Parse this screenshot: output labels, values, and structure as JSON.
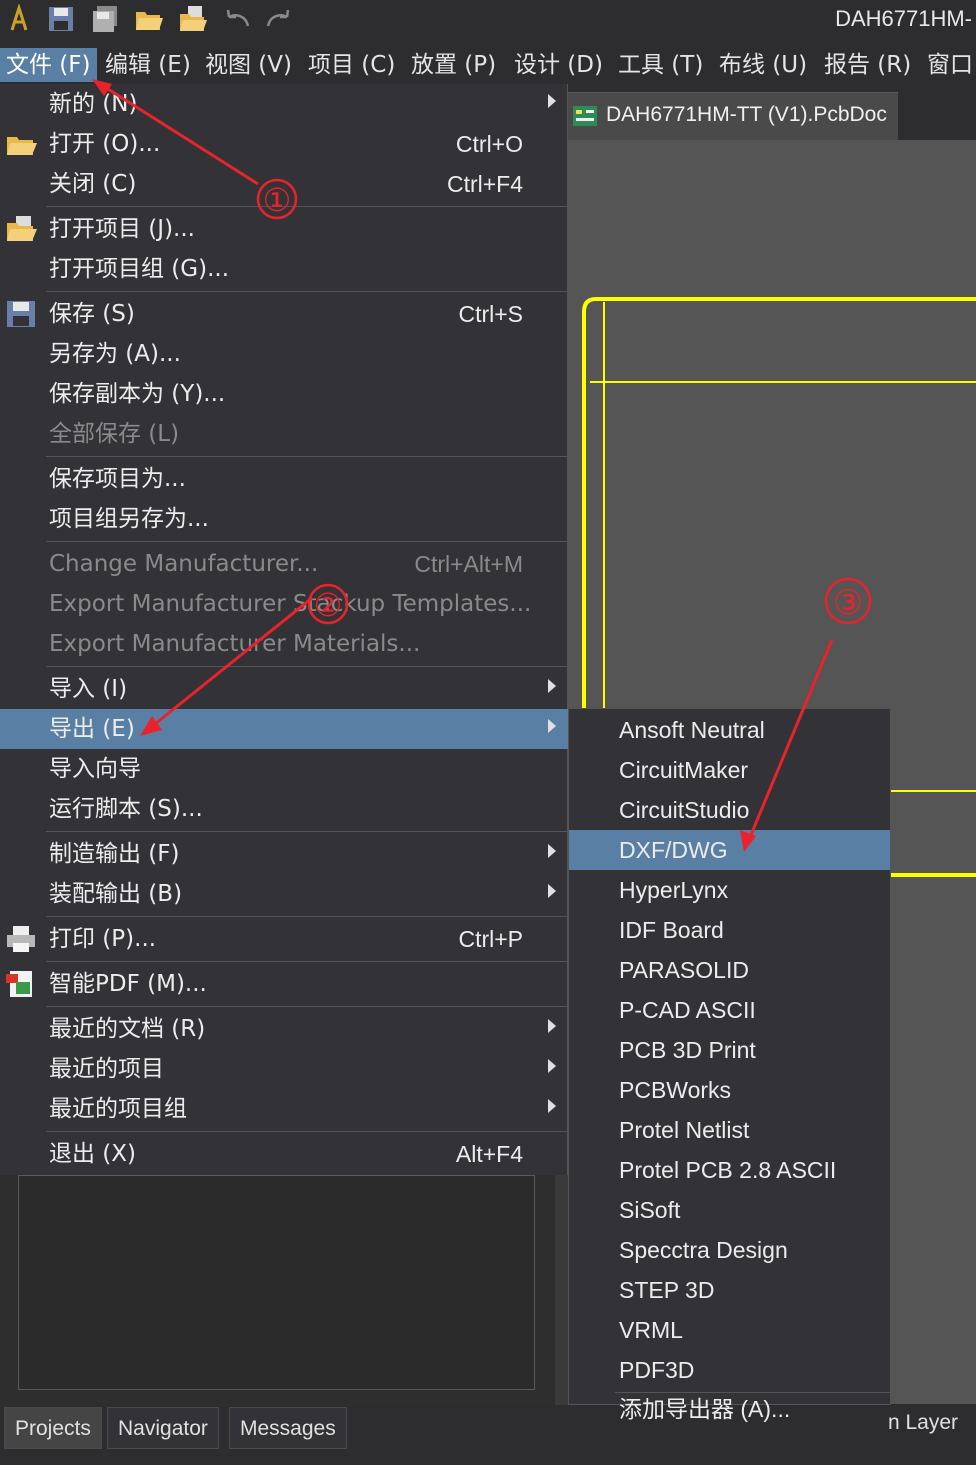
{
  "window": {
    "title": "DAH6771HM-"
  },
  "toolbar": {
    "icons": [
      "app-logo-icon",
      "save-icon",
      "save-all-icon",
      "open-icon",
      "open-project-icon",
      "undo-icon",
      "redo-icon"
    ]
  },
  "menubar": {
    "items": [
      {
        "label": "文件 (F)",
        "active": true
      },
      {
        "label": "编辑 (E)"
      },
      {
        "label": "视图 (V)"
      },
      {
        "label": "项目 (C)"
      },
      {
        "label": "放置 (P)"
      },
      {
        "label": "设计 (D)"
      },
      {
        "label": "工具 (T)"
      },
      {
        "label": "布线 (U)"
      },
      {
        "label": "报告 (R)"
      },
      {
        "label": "窗口"
      }
    ]
  },
  "document": {
    "tab_label": "DAH6771HM-TT (V1).PcbDoc"
  },
  "file_menu": {
    "items": [
      {
        "label": "新的 (N)",
        "shortcut": "",
        "submenu": true
      },
      {
        "label": "打开 (O)...",
        "shortcut": "Ctrl+O",
        "icon": "open-folder-icon"
      },
      {
        "label": "关闭 (C)",
        "shortcut": "Ctrl+F4"
      },
      {
        "label": "打开项目 (J)...",
        "shortcut": "",
        "icon": "open-project-icon"
      },
      {
        "label": "打开项目组 (G)...",
        "shortcut": ""
      },
      {
        "label": "保存 (S)",
        "shortcut": "Ctrl+S",
        "icon": "save-icon"
      },
      {
        "label": "另存为 (A)...",
        "shortcut": ""
      },
      {
        "label": "保存副本为 (Y)...",
        "shortcut": ""
      },
      {
        "label": "全部保存 (L)",
        "shortcut": "",
        "disabled": true
      },
      {
        "label": "保存项目为...",
        "shortcut": ""
      },
      {
        "label": "项目组另存为...",
        "shortcut": ""
      },
      {
        "label": "Change Manufacturer...",
        "shortcut": "Ctrl+Alt+M",
        "disabled": true
      },
      {
        "label": "Export Manufacturer Stackup Templates...",
        "shortcut": "",
        "disabled": true
      },
      {
        "label": "Export Manufacturer Materials...",
        "shortcut": "",
        "disabled": true
      },
      {
        "label": "导入 (I)",
        "shortcut": "",
        "submenu": true
      },
      {
        "label": "导出 (E)",
        "shortcut": "",
        "submenu": true,
        "highlight": true
      },
      {
        "label": "导入向导",
        "shortcut": ""
      },
      {
        "label": "运行脚本 (S)...",
        "shortcut": ""
      },
      {
        "label": "制造输出 (F)",
        "shortcut": "",
        "submenu": true
      },
      {
        "label": "装配输出 (B)",
        "shortcut": "",
        "submenu": true
      },
      {
        "label": "打印 (P)...",
        "shortcut": "Ctrl+P",
        "icon": "printer-icon"
      },
      {
        "label": "智能PDF (M)...",
        "shortcut": "",
        "icon": "smart-pdf-icon"
      },
      {
        "label": "最近的文档 (R)",
        "shortcut": "",
        "submenu": true
      },
      {
        "label": "最近的项目",
        "shortcut": "",
        "submenu": true
      },
      {
        "label": "最近的项目组",
        "shortcut": "",
        "submenu": true
      },
      {
        "label": "退出 (X)",
        "shortcut": "Alt+F4"
      }
    ]
  },
  "export_submenu": {
    "items": [
      {
        "label": "Ansoft Neutral"
      },
      {
        "label": "CircuitMaker"
      },
      {
        "label": "CircuitStudio"
      },
      {
        "label": "DXF/DWG",
        "highlight": true
      },
      {
        "label": "HyperLynx"
      },
      {
        "label": "IDF Board"
      },
      {
        "label": "PARASOLID"
      },
      {
        "label": "P-CAD ASCII"
      },
      {
        "label": "PCB 3D Print"
      },
      {
        "label": "PCBWorks"
      },
      {
        "label": "Protel Netlist"
      },
      {
        "label": "Protel PCB 2.8 ASCII"
      },
      {
        "label": "SiSoft"
      },
      {
        "label": "Specctra Design"
      },
      {
        "label": "STEP 3D"
      },
      {
        "label": "VRML"
      },
      {
        "label": "PDF3D"
      },
      {
        "label": "添加导出器 (A)..."
      }
    ]
  },
  "bottom_tabs": {
    "items": [
      {
        "label": "Projects",
        "active": true
      },
      {
        "label": "Navigator"
      },
      {
        "label": "Messages"
      }
    ],
    "layer_label": "n Layer"
  },
  "annotations": {
    "step1": "①",
    "step2": "②",
    "step3": "③",
    "color": "#e8232b"
  },
  "colors": {
    "menu_bg": "#333337",
    "highlight": "#5a7fa5",
    "board_outline": "#ffff00",
    "canvas": "#555555"
  }
}
